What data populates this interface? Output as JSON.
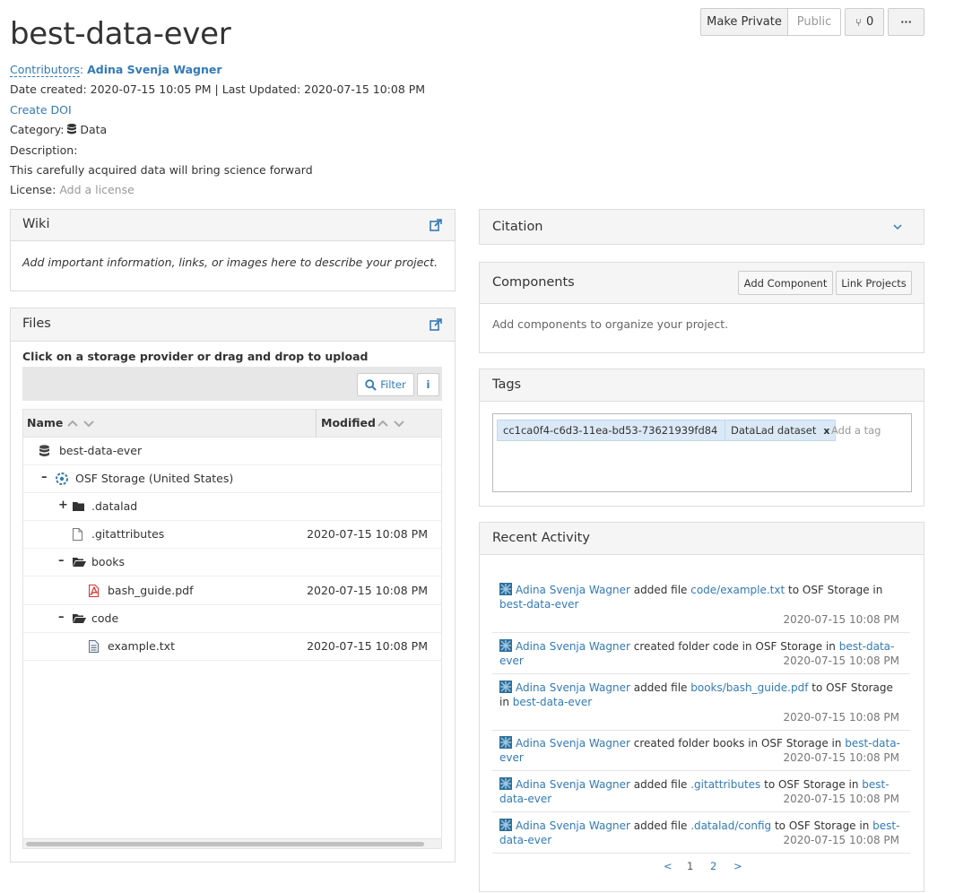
{
  "project": {
    "title": "best-data-ever",
    "contributors_label": "Contributors",
    "contributor": "Adina Svenja Wagner",
    "dates": "Date created: 2020-07-15 10:05 PM | Last Updated: 2020-07-15 10:08 PM",
    "create_doi": "Create DOI",
    "category_label": "Category:",
    "category": "Data",
    "description_label": "Description:",
    "description": "This carefully acquired data will bring science forward",
    "license_label": "License:",
    "license_action": "Add a license"
  },
  "toolbar": {
    "make_private": "Make Private",
    "public": "Public",
    "fork_count": "0",
    "more": "···"
  },
  "wiki": {
    "title": "Wiki",
    "placeholder": "Add important information, links, or images here to describe your project."
  },
  "files": {
    "title": "Files",
    "hint": "Click on a storage provider or drag and drop to upload",
    "filter": "Filter",
    "info": "i",
    "col_name": "Name",
    "col_modified": "Modified",
    "rows": [
      {
        "toggle": "",
        "name": "best-data-ever",
        "modified": "",
        "icon": "database-icon"
      },
      {
        "toggle": "–",
        "name": "OSF Storage (United States)",
        "modified": "",
        "icon": "osf-storage-icon"
      },
      {
        "toggle": "+",
        "name": ".datalad",
        "modified": "",
        "icon": "folder-icon"
      },
      {
        "toggle": "",
        "name": ".gitattributes",
        "modified": "2020-07-15 10:08 PM",
        "icon": "file-icon"
      },
      {
        "toggle": "–",
        "name": "books",
        "modified": "",
        "icon": "folder-open-icon"
      },
      {
        "toggle": "",
        "name": "bash_guide.pdf",
        "modified": "2020-07-15 10:08 PM",
        "icon": "pdf-icon"
      },
      {
        "toggle": "–",
        "name": "code",
        "modified": "",
        "icon": "folder-open-icon"
      },
      {
        "toggle": "",
        "name": "example.txt",
        "modified": "2020-07-15 10:08 PM",
        "icon": "text-file-icon"
      }
    ]
  },
  "citation": {
    "title": "Citation"
  },
  "components": {
    "title": "Components",
    "add": "Add Component",
    "link": "Link Projects",
    "empty": "Add components to organize your project."
  },
  "tags": {
    "title": "Tags",
    "items": [
      "cc1ca0f4-c6d3-11ea-bd53-73621939fd84",
      "DataLad dataset"
    ],
    "remove": "x",
    "placeholder": "Add a tag"
  },
  "activity": {
    "title": "Recent Activity",
    "items": [
      {
        "user": "Adina Svenja Wagner",
        "pre": " added file ",
        "target": "code/example.txt",
        "mid": " to OSF Storage in ",
        "project": "best-data-ever",
        "time": "2020-07-15 10:08 PM"
      },
      {
        "user": "Adina Svenja Wagner",
        "pre": " created folder code in OSF Storage in ",
        "target": "",
        "mid": "",
        "project": "best-data-ever",
        "time": "2020-07-15 10:08 PM"
      },
      {
        "user": "Adina Svenja Wagner",
        "pre": " added file ",
        "target": "books/bash_guide.pdf",
        "mid": " to OSF Storage in ",
        "project": "best-data-ever",
        "time": "2020-07-15 10:08 PM"
      },
      {
        "user": "Adina Svenja Wagner",
        "pre": " created folder books in OSF Storage in ",
        "target": "",
        "mid": "",
        "project": "best-data-ever",
        "time": "2020-07-15 10:08 PM"
      },
      {
        "user": "Adina Svenja Wagner",
        "pre": " added file ",
        "target": ".gitattributes",
        "mid": " to OSF Storage in ",
        "project": "best-data-ever",
        "time": "2020-07-15 10:08 PM"
      },
      {
        "user": "Adina Svenja Wagner",
        "pre": " added file ",
        "target": ".datalad/config",
        "mid": " to OSF Storage in ",
        "project": "best-data-ever",
        "time": "2020-07-15 10:08 PM"
      }
    ],
    "pager": {
      "prev": "<",
      "p1": "1",
      "p2": "2",
      "next": ">"
    }
  }
}
